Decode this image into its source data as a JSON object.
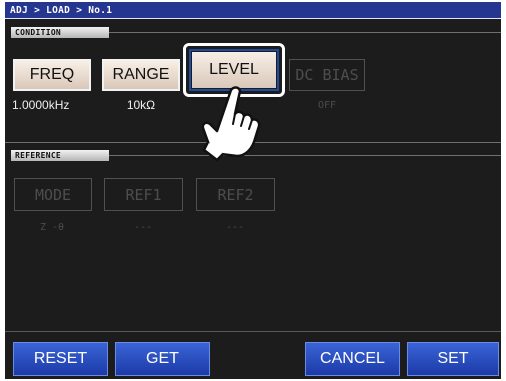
{
  "breadcrumb": "ADJ > LOAD > No.1",
  "condition": {
    "label": "CONDITION",
    "buttons": [
      {
        "label": "FREQ",
        "value": "1.0000kHz",
        "state": "active"
      },
      {
        "label": "RANGE",
        "value": "10kΩ",
        "state": "active"
      },
      {
        "label": "LEVEL",
        "value": "",
        "state": "selected"
      },
      {
        "label": "DC BIAS",
        "value": "OFF",
        "state": "disabled"
      }
    ]
  },
  "reference": {
    "label": "REFERENCE",
    "buttons": [
      {
        "label": "MODE",
        "value": "Z -θ"
      },
      {
        "label": "REF1",
        "value": "---"
      },
      {
        "label": "REF2",
        "value": "---"
      }
    ]
  },
  "footer": {
    "reset_label": "RESET",
    "get_label": "GET",
    "cancel_label": "CANCEL",
    "set_label": "SET"
  },
  "icons": {
    "pointer": "hand-pointer-icon"
  },
  "colors": {
    "titlebar": "#24368f",
    "background": "#1c1c1c",
    "active_button": "#f0e4d8",
    "footer_button": "#2b4fc4",
    "focus_ring": "#1e4aa0"
  }
}
